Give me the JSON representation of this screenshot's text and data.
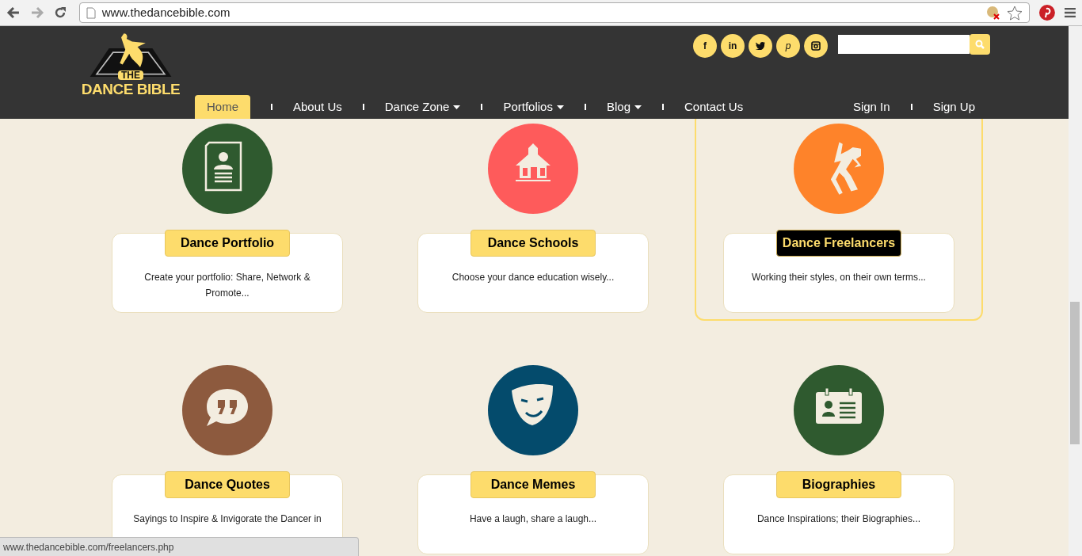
{
  "browser": {
    "url": "www.thedancebible.com"
  },
  "logo": {
    "small": "THE",
    "large": "DANCE BIBLE"
  },
  "social": [
    {
      "kind": "facebook",
      "label": "f"
    },
    {
      "kind": "linkedin",
      "label": "in"
    },
    {
      "kind": "twitter"
    },
    {
      "kind": "pinterest",
      "label": "p"
    },
    {
      "kind": "instagram"
    }
  ],
  "nav": [
    {
      "label": "Home",
      "dropdown": false,
      "selected": true
    },
    {
      "label": "About Us",
      "dropdown": false,
      "selected": false
    },
    {
      "label": "Dance Zone",
      "dropdown": true,
      "selected": false
    },
    {
      "label": "Portfolios",
      "dropdown": true,
      "selected": false
    },
    {
      "label": "Blog",
      "dropdown": true,
      "selected": false
    },
    {
      "label": "Contact Us",
      "dropdown": false,
      "selected": false
    }
  ],
  "auth": [
    "Sign In",
    "Sign Up"
  ],
  "sections": [
    {
      "title": "Dance Portfolio",
      "description": "Create your portfolio: Share, Network & Promote...",
      "kind": "resume",
      "color": "#2f5a2f",
      "selected": false
    },
    {
      "title": "Dance Schools",
      "description": "Choose your dance education wisely...",
      "kind": "school",
      "color": "#fe5b5b",
      "selected": false
    },
    {
      "title": "Dance Freelancers",
      "description": "Working their styles, on their own terms...",
      "kind": "dancer",
      "color": "#fe832a",
      "selected": true
    },
    {
      "title": "Dance Quotes",
      "description": "Sayings to Inspire & Invigorate the Dancer in",
      "kind": "quote",
      "color": "#8d5a3e",
      "selected": false
    },
    {
      "title": "Dance Memes",
      "description": "Have a laugh, share a laugh...",
      "kind": "mask",
      "color": "#044b6c",
      "selected": false
    },
    {
      "title": "Biographies",
      "description": "Dance Inspirations; their Biographies...",
      "kind": "idcard",
      "color": "#2f5a2f",
      "selected": false
    }
  ],
  "status_bar": {
    "url": "www.thedancebible.com/freelancers.php"
  }
}
